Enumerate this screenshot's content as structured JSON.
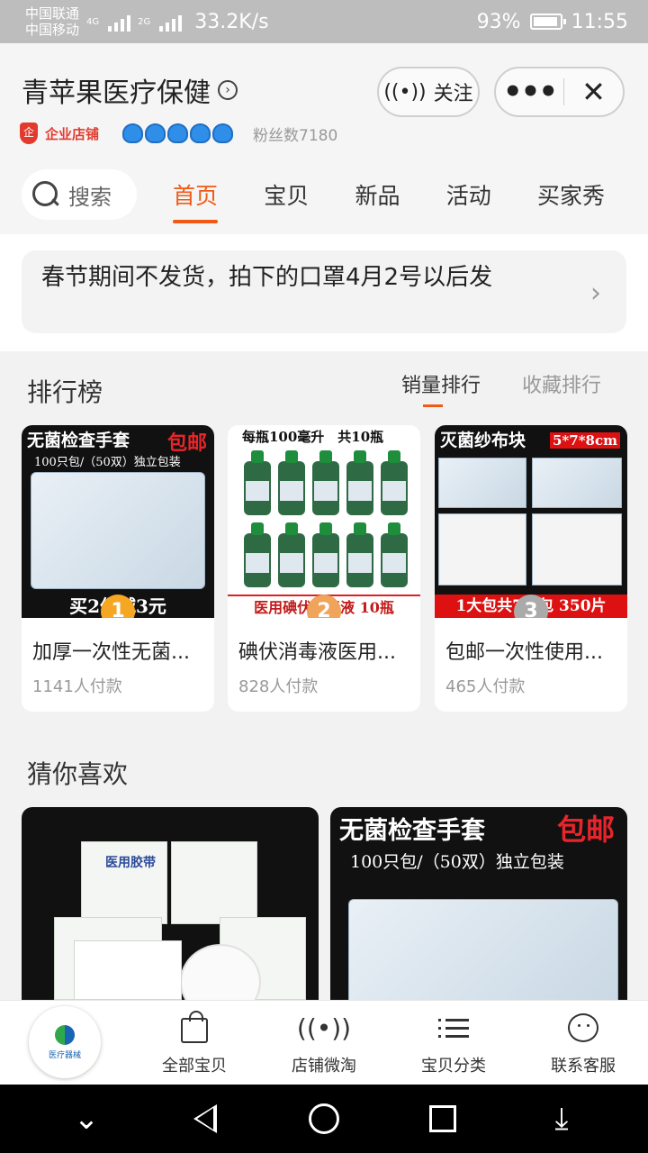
{
  "status_bar": {
    "carrier1": "中国联通",
    "carrier2": "中国移动",
    "net1": "4G",
    "net2": "2G",
    "speed": "33.2K/s",
    "battery": "93%",
    "time": "11:55"
  },
  "header": {
    "shop_name": "青苹果医疗保健",
    "follow_label": "关注",
    "more_label": "•••",
    "close_label": "✕",
    "enterprise_label": "企业店铺",
    "fans": "粉丝数7180"
  },
  "search": {
    "label": "搜索"
  },
  "tabs": [
    {
      "label": "首页"
    },
    {
      "label": "宝贝"
    },
    {
      "label": "新品"
    },
    {
      "label": "活动"
    },
    {
      "label": "买家秀"
    }
  ],
  "notice": {
    "text": "春节期间不发货，拍下的口罩4月2号以后发"
  },
  "ranking": {
    "title": "排行榜",
    "tab_sales": "销量排行",
    "tab_favorites": "收藏排行",
    "items": [
      {
        "rank": "1",
        "title": "加厚一次性无菌...",
        "sales": "1141人付款",
        "img_caption": "无菌检查手套",
        "img_badge": "包邮",
        "img_sub": "100只包/（50双）独立包装",
        "img_bottom": "买2件减3元"
      },
      {
        "rank": "2",
        "title": "碘伏消毒液医用...",
        "sales": "828人付款",
        "img_caption": "每瓶100毫升　共10瓶",
        "img_bottom": "医用碘伏消毒液 10瓶"
      },
      {
        "rank": "3",
        "title": "包邮一次性使用...",
        "sales": "465人付款",
        "img_caption": "灭菌纱布块",
        "img_badge": "5*7*8cm",
        "img_bottom": "1大包共7小包 350片"
      }
    ]
  },
  "guess": {
    "title": "猜你喜欢",
    "items": [
      {
        "label_box": "医用胶带"
      },
      {
        "caption": "无菌检查手套",
        "badge": "包邮",
        "sub": "100只包/（50双）独立包装"
      }
    ]
  },
  "bottom_nav": {
    "logo_text": "医疗器械",
    "items": [
      {
        "label": "全部宝贝"
      },
      {
        "label": "店铺微淘"
      },
      {
        "label": "宝贝分类"
      },
      {
        "label": "联系客服"
      }
    ]
  },
  "colors": {
    "accent": "#f05a16",
    "enterprise_red": "#e23b2e",
    "crown_blue": "#2f8ee8"
  },
  "icons": [
    "search-icon",
    "broadcast-icon",
    "more-icon",
    "close-icon",
    "chevron-right-icon",
    "bag-icon",
    "list-icon",
    "chat-icon"
  ]
}
